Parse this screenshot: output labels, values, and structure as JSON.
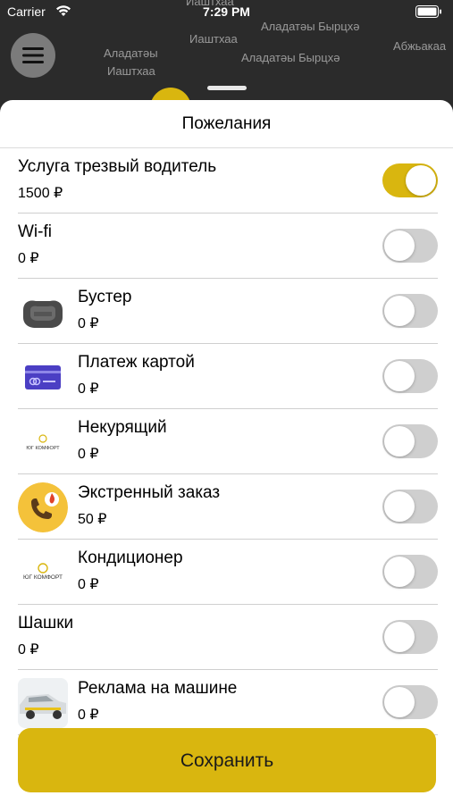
{
  "status_bar": {
    "carrier": "Carrier",
    "time": "7:29 PM"
  },
  "map": {
    "labels": [
      "Иаштхаа",
      "Аладатәы Бырцхә",
      "Аладатәы",
      "Иаштхаа",
      "Иаштхаа",
      "Аладатәы Бырцхә",
      "Абжьакаа"
    ]
  },
  "sheet": {
    "title": "Пожелания",
    "items": [
      {
        "title": "Услуга трезвый водитель",
        "price": "1500 ₽",
        "enabled": true,
        "icon": ""
      },
      {
        "title": "Wi-fi",
        "price": "0 ₽",
        "enabled": false,
        "icon": ""
      },
      {
        "title": "Бустер",
        "price": "0 ₽",
        "enabled": false,
        "icon": "booster-seat-icon"
      },
      {
        "title": "Платеж картой",
        "price": "0 ₽",
        "enabled": false,
        "icon": "credit-card-icon"
      },
      {
        "title": "Некурящий",
        "price": "0 ₽",
        "enabled": false,
        "icon": "logo-icon"
      },
      {
        "title": "Экстренный заказ",
        "price": "50 ₽",
        "enabled": false,
        "icon": "phone-flame-icon"
      },
      {
        "title": "Кондиционер",
        "price": "0 ₽",
        "enabled": false,
        "icon": "logo-icon"
      },
      {
        "title": "Шашки",
        "price": "0 ₽",
        "enabled": false,
        "icon": ""
      },
      {
        "title": "Реклама на машине",
        "price": "0 ₽",
        "enabled": false,
        "icon": "taxi-car-icon"
      }
    ],
    "logo_text": "ЮГ КОМФОРТ",
    "save_label": "Сохранить"
  },
  "colors": {
    "accent": "#d9b60f",
    "toggle_off": "#cfcfcf",
    "map_bg": "#2b2b2b"
  }
}
